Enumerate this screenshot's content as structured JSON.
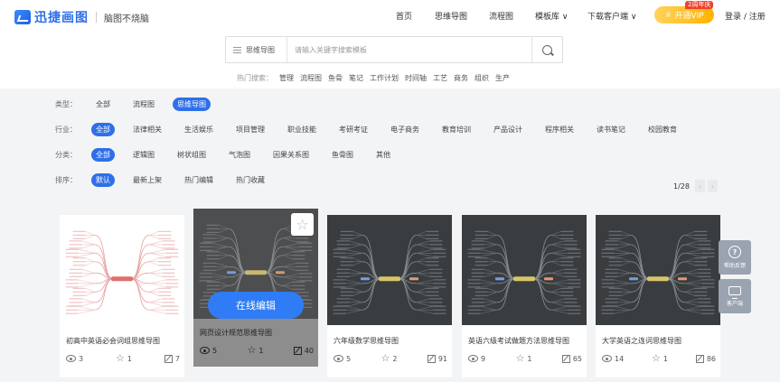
{
  "header": {
    "logo_text": "迅捷画图",
    "slogan": "脑图不烧脑",
    "nav": [
      "首页",
      "思维导图",
      "流程图",
      "模板库 ∨",
      "下载客户端 ∨"
    ],
    "vip_label": "开通VIP",
    "vip_badge": "2周年庆",
    "login": "登录 / 注册"
  },
  "search": {
    "type_label": "思维导图",
    "placeholder": "请输入关键字搜索模板",
    "hot_label": "热门搜索：",
    "hot_keywords": [
      "管理",
      "流程图",
      "鱼骨",
      "笔记",
      "工作计划",
      "时间轴",
      "工艺",
      "商务",
      "组织",
      "生产"
    ]
  },
  "filters": {
    "type": {
      "label": "类型：",
      "options": [
        "全部",
        "流程图",
        "思维导图"
      ],
      "active": 2
    },
    "industry": {
      "label": "行业：",
      "options": [
        "全部",
        "法律相关",
        "生活娱乐",
        "项目管理",
        "职业技能",
        "考研考证",
        "电子商务",
        "教育培训",
        "产品设计",
        "程序相关",
        "读书笔记",
        "校园教育"
      ],
      "active": 0
    },
    "category": {
      "label": "分类：",
      "options": [
        "全部",
        "逻辑图",
        "树状组图",
        "气泡图",
        "因果关系图",
        "鱼骨图",
        "其他"
      ],
      "active": 0
    },
    "sort": {
      "label": "排序：",
      "options": [
        "默认",
        "最新上架",
        "热门编辑",
        "热门收藏"
      ],
      "active": 0
    }
  },
  "pager": {
    "text": "1/28",
    "prev": "‹",
    "next": "›"
  },
  "cards": [
    {
      "title": "初高中英语必会词组思维导图",
      "views": "3",
      "stars": "1",
      "edits": "7",
      "theme": "light"
    },
    {
      "title": "网页设计规范思维导图",
      "views": "5",
      "stars": "1",
      "edits": "40",
      "theme": "dark",
      "edit_label": "在线编辑"
    },
    {
      "title": "六年级数学思维导图",
      "views": "5",
      "stars": "2",
      "edits": "91",
      "theme": "dark"
    },
    {
      "title": "英语六级考试做题方法思维导图",
      "views": "9",
      "stars": "1",
      "edits": "65",
      "theme": "dark"
    },
    {
      "title": "大学英语之连词思维导图",
      "views": "14",
      "stars": "1",
      "edits": "86",
      "theme": "dark"
    }
  ],
  "side": {
    "help": "帮助反馈",
    "client": "客户端"
  },
  "colors": {
    "brand": "#2f6fe8",
    "vip": "#ffb300",
    "dark_thumb": "#3a3d40"
  }
}
